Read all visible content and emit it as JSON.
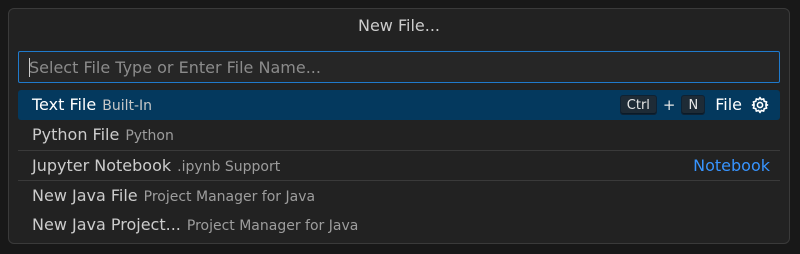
{
  "title": "New File...",
  "input": {
    "placeholder": "Select File Type or Enter File Name...",
    "value": ""
  },
  "items": [
    {
      "label": "Text File",
      "description": "Built-In",
      "selected": true
    },
    {
      "label": "Python File",
      "description": "Python"
    },
    {
      "label": "Jupyter Notebook",
      "description": ".ipynb Support",
      "category": "Notebook"
    },
    {
      "label": "New Java File",
      "description": "Project Manager for Java"
    },
    {
      "label": "New Java Project...",
      "description": "Project Manager for Java"
    }
  ],
  "keybinding": {
    "key1": "Ctrl",
    "plus": "+",
    "key2": "N",
    "suffix": "File"
  },
  "icons": {
    "configure": "gear-icon"
  },
  "colors": {
    "accent": "#1f7acc",
    "selection": "#04395e",
    "category": "#3794ff"
  }
}
